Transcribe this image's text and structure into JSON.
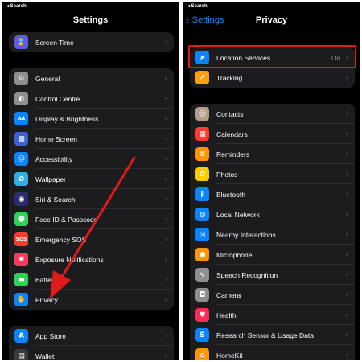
{
  "left": {
    "status": "◂ Search",
    "title": "Settings",
    "group0": [
      {
        "label": "Screen Time",
        "icon": "hourglass-icon",
        "glyph": "⌛",
        "color": "#5e5ce6"
      }
    ],
    "group1": [
      {
        "label": "General",
        "icon": "gear-icon",
        "glyph": "⚙",
        "color": "#8e8e93"
      },
      {
        "label": "Control Centre",
        "icon": "toggles-icon",
        "glyph": "◐",
        "color": "#8e8e93"
      },
      {
        "label": "Display & Brightness",
        "icon": "text-size-icon",
        "glyph": "AA",
        "color": "#0a84ff"
      },
      {
        "label": "Home Screen",
        "icon": "grid-icon",
        "glyph": "▦",
        "color": "#3a62d6"
      },
      {
        "label": "Accessibility",
        "icon": "accessibility-icon",
        "glyph": "☺",
        "color": "#0a84ff"
      },
      {
        "label": "Wallpaper",
        "icon": "flower-icon",
        "glyph": "✿",
        "color": "#32ade6"
      },
      {
        "label": "Siri & Search",
        "icon": "siri-icon",
        "glyph": "◉",
        "color": "#2c2c6e"
      },
      {
        "label": "Face ID & Passcode",
        "icon": "face-id-icon",
        "glyph": "☻",
        "color": "#30d158"
      },
      {
        "label": "Emergency SOS",
        "icon": "sos-icon",
        "glyph": "SOS",
        "color": "#ff3b30"
      },
      {
        "label": "Exposure Notifications",
        "icon": "exposure-icon",
        "glyph": "✺",
        "color": "#ff375f"
      },
      {
        "label": "Battery",
        "icon": "battery-icon",
        "glyph": "▬",
        "color": "#30d158"
      },
      {
        "label": "Privacy",
        "icon": "hand-icon",
        "glyph": "✋",
        "color": "#0a84ff"
      }
    ],
    "group2": [
      {
        "label": "App Store",
        "icon": "app-store-icon",
        "glyph": "A",
        "color": "#0a84ff"
      },
      {
        "label": "Wallet",
        "icon": "wallet-icon",
        "glyph": "▤",
        "color": "#3a3a3c"
      }
    ]
  },
  "right": {
    "status": "◂ Search",
    "back_label": "Settings",
    "title": "Privacy",
    "group0": [
      {
        "label": "Location Services",
        "value": "On",
        "icon": "location-arrow-icon",
        "glyph": "➤",
        "color": "#0a84ff"
      },
      {
        "label": "Tracking",
        "value": "",
        "icon": "tracking-icon",
        "glyph": "↗",
        "color": "#ff9f0a"
      }
    ],
    "group1": [
      {
        "label": "Contacts",
        "icon": "contacts-icon",
        "glyph": "☺",
        "color": "#b0a08a"
      },
      {
        "label": "Calendars",
        "icon": "calendar-icon",
        "glyph": "▦",
        "color": "#ff3b30"
      },
      {
        "label": "Reminders",
        "icon": "reminders-icon",
        "glyph": "≡",
        "color": "#ff9500"
      },
      {
        "label": "Photos",
        "icon": "photos-icon",
        "glyph": "✿",
        "color": "#ffcc00"
      },
      {
        "label": "Bluetooth",
        "icon": "bluetooth-icon",
        "glyph": "ᛒ",
        "color": "#0a84ff"
      },
      {
        "label": "Local Network",
        "icon": "globe-icon",
        "glyph": "◍",
        "color": "#0a84ff"
      },
      {
        "label": "Nearby Interactions",
        "icon": "nearby-icon",
        "glyph": "◎",
        "color": "#0a84ff"
      },
      {
        "label": "Microphone",
        "icon": "microphone-icon",
        "glyph": "●",
        "color": "#ff9500"
      },
      {
        "label": "Speech Recognition",
        "icon": "waveform-icon",
        "glyph": "∿",
        "color": "#8e8e93"
      },
      {
        "label": "Camera",
        "icon": "camera-icon",
        "glyph": "◘",
        "color": "#8e8e93"
      },
      {
        "label": "Health",
        "icon": "heart-icon",
        "glyph": "♥",
        "color": "#ff2d55"
      },
      {
        "label": "Research Sensor & Usage Data",
        "icon": "research-icon",
        "glyph": "S",
        "color": "#0a84ff"
      },
      {
        "label": "HomeKit",
        "icon": "home-icon",
        "glyph": "⌂",
        "color": "#ff9500"
      }
    ]
  },
  "annotation": {
    "highlight_color": "#e11a1a",
    "arrow_color": "#e11a1a"
  }
}
